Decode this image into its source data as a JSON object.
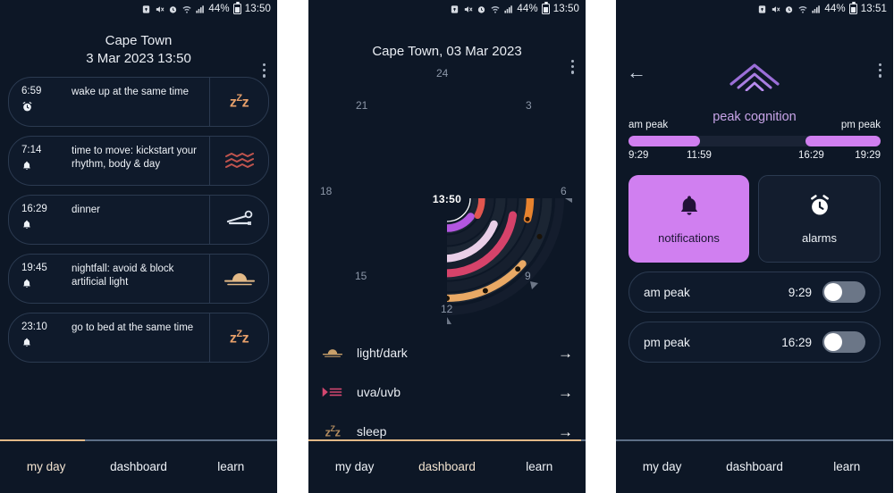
{
  "statusbar": {
    "icons": [
      "lock-icon",
      "mute-icon",
      "alarm-icon",
      "wifi-icon",
      "signal-icon"
    ],
    "battery_percent": "44%",
    "time_panel1": "13:50",
    "time_panel2": "13:50",
    "time_panel3": "13:51"
  },
  "colors": {
    "background": "#0d1726",
    "accent_orange": "#e2b987",
    "accent_purple": "#d07ff0",
    "card_border": "#2b3a50",
    "text": "#eef2f7",
    "muted": "#8c97a8"
  },
  "panel1": {
    "title_line1": "Cape Town",
    "title_line2": "3 Mar 2023 13:50",
    "menu": "more-options",
    "cards": [
      {
        "time": "6:59",
        "time_icon": "alarm-clock-icon",
        "label": "wake up at the same time",
        "right_icon": "zzz-icon",
        "right_text": "zZz"
      },
      {
        "time": "7:14",
        "time_icon": "bell-icon",
        "label": "time to move: kickstart your rhythm, body & day",
        "right_icon": "waves-icon",
        "right_text": ""
      },
      {
        "time": "16:29",
        "time_icon": "bell-icon",
        "label": "dinner",
        "right_icon": "cutlery-icon",
        "right_text": ""
      },
      {
        "time": "19:45",
        "time_icon": "bell-icon",
        "label": "nightfall: avoid & block artificial light",
        "right_icon": "sunset-icon",
        "right_text": ""
      },
      {
        "time": "23:10",
        "time_icon": "bell-icon",
        "label": "go to bed at the same time",
        "right_icon": "zzz-icon",
        "right_text": "zZz"
      }
    ],
    "nav": {
      "items": [
        "my day",
        "dashboard",
        "learn"
      ],
      "active": "my day"
    }
  },
  "panel2": {
    "title": "Cape Town, 03 Mar 2023",
    "menu": "more-options",
    "dial": {
      "center_time": "13:50",
      "hour_labels": [
        "24",
        "3",
        "6",
        "9",
        "12",
        "15",
        "18",
        "21"
      ]
    },
    "list": [
      {
        "icon": "sunset-icon",
        "label": "light/dark",
        "arrow": "arrow-right-icon"
      },
      {
        "icon": "uv-icon",
        "label": "uva/uvb",
        "arrow": "arrow-right-icon"
      },
      {
        "icon": "zzz-icon",
        "label": "sleep",
        "arrow": "arrow-right-icon"
      }
    ],
    "nav": {
      "items": [
        "my day",
        "dashboard",
        "learn"
      ],
      "active": "dashboard"
    }
  },
  "panel3": {
    "back": "back-arrow-icon",
    "menu": "more-options",
    "brand_icon": "peak-chevron-icon",
    "title": "peak cognition",
    "peaks": {
      "am_label": "am peak",
      "pm_label": "pm peak",
      "am_start": "9:29",
      "am_end": "11:59",
      "pm_start": "16:29",
      "pm_end": "19:29"
    },
    "tiles": [
      {
        "icon": "bell-icon",
        "label": "notifications",
        "selected": true
      },
      {
        "icon": "alarm-clock-icon",
        "label": "alarms",
        "selected": false
      }
    ],
    "toggles": [
      {
        "label": "am peak",
        "value": "9:29",
        "state": "off"
      },
      {
        "label": "pm peak",
        "value": "16:29",
        "state": "off"
      }
    ],
    "nav": {
      "items": [
        "my day",
        "dashboard",
        "learn"
      ],
      "active": ""
    }
  },
  "chart_data": {
    "type": "pie",
    "title": "24-hour circadian dial",
    "center_label": "13:50",
    "axis_ticks": [
      "24",
      "3",
      "6",
      "9",
      "12",
      "15",
      "18",
      "21"
    ],
    "rings": [
      {
        "name": "outer daylight ring",
        "color": "#f4b068",
        "start_hour": 5.5,
        "end_hour": 20.5,
        "radius": 112
      },
      {
        "name": "uv ring",
        "color": "#e8832e",
        "start_hour": 23.4,
        "end_hour": 5.6,
        "radius": 93
      },
      {
        "name": "uvb ring",
        "color": "#e0456e",
        "start_hour": 8.2,
        "end_hour": 19.2,
        "radius": 76
      },
      {
        "name": "sleep ring",
        "color": "#e9cfe8",
        "start_hour": 9.3,
        "end_hour": 17.6,
        "radius": 60
      },
      {
        "name": "inner red arc",
        "color": "#e2564f",
        "start_hour": 21.6,
        "end_hour": 23.3,
        "radius": 44
      },
      {
        "name": "inner purple arc",
        "color": "#b356e0",
        "start_hour": 23.3,
        "end_hour": 0.6,
        "radius": 36
      },
      {
        "name": "inner red arc 2",
        "color": "#e2564f",
        "start_hour": 4.1,
        "end_hour": 5.2,
        "radius": 44
      },
      {
        "name": "inner purple arc 2",
        "color": "#b356e0",
        "start_hour": 6.0,
        "end_hour": 7.4,
        "radius": 34
      }
    ],
    "legend_position": "none",
    "grid": false
  }
}
